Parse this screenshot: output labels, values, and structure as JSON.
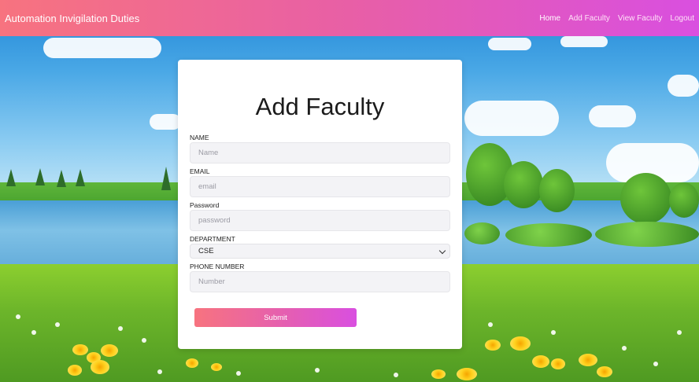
{
  "navbar": {
    "brand": "Automation Invigilation Duties",
    "links": [
      {
        "label": "Home"
      },
      {
        "label": "Add Faculty"
      },
      {
        "label": "View Faculty"
      },
      {
        "label": "Logout"
      }
    ]
  },
  "form": {
    "title": "Add Faculty",
    "fields": {
      "name": {
        "label": "NAME",
        "placeholder": "Name",
        "value": ""
      },
      "email": {
        "label": "EMAIL",
        "placeholder": "email",
        "value": ""
      },
      "password": {
        "label": "Password",
        "placeholder": "password",
        "value": ""
      },
      "department": {
        "label": "DEPARTMENT",
        "selected": "CSE"
      },
      "phone": {
        "label": "PHONE NUMBER",
        "placeholder": "Number",
        "value": ""
      }
    },
    "submit_label": "Submit"
  },
  "colors": {
    "navbar_gradient_start": "#f7737f",
    "navbar_gradient_end": "#d94fe0",
    "card_background": "#ffffff",
    "input_background": "#f3f3f6"
  }
}
